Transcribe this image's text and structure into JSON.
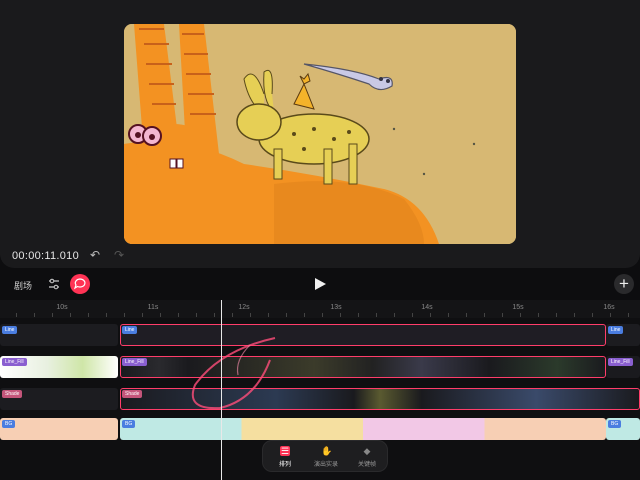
{
  "preview": {
    "timecode": "00:00:11.010"
  },
  "toolbar": {
    "scene_label": "剧场"
  },
  "ruler": {
    "labels": [
      "10s",
      "11s",
      "12s",
      "13s",
      "14s",
      "15s",
      "16s"
    ]
  },
  "tracks": [
    {
      "tag_left": "Line",
      "tag_main": "Line",
      "tag_right": "Line"
    },
    {
      "tag_left": "Line_Fill",
      "tag_main": "Line_Fill",
      "tag_right": "Line_Fill"
    },
    {
      "tag_left": "Shade",
      "tag_main": "Shade"
    },
    {
      "tag_left": "BG",
      "tag_main": "BG",
      "tag_right": "BG"
    }
  ],
  "menu": [
    {
      "label": "排列",
      "icon": "arrange-icon"
    },
    {
      "label": "演出实录",
      "icon": "hand-icon"
    },
    {
      "label": "关键帧",
      "icon": "keyframe-icon"
    }
  ],
  "colors": {
    "accent": "#ff3d6a",
    "clip_blue": "#4a7de0",
    "clip_purple": "#8a5fd0"
  }
}
